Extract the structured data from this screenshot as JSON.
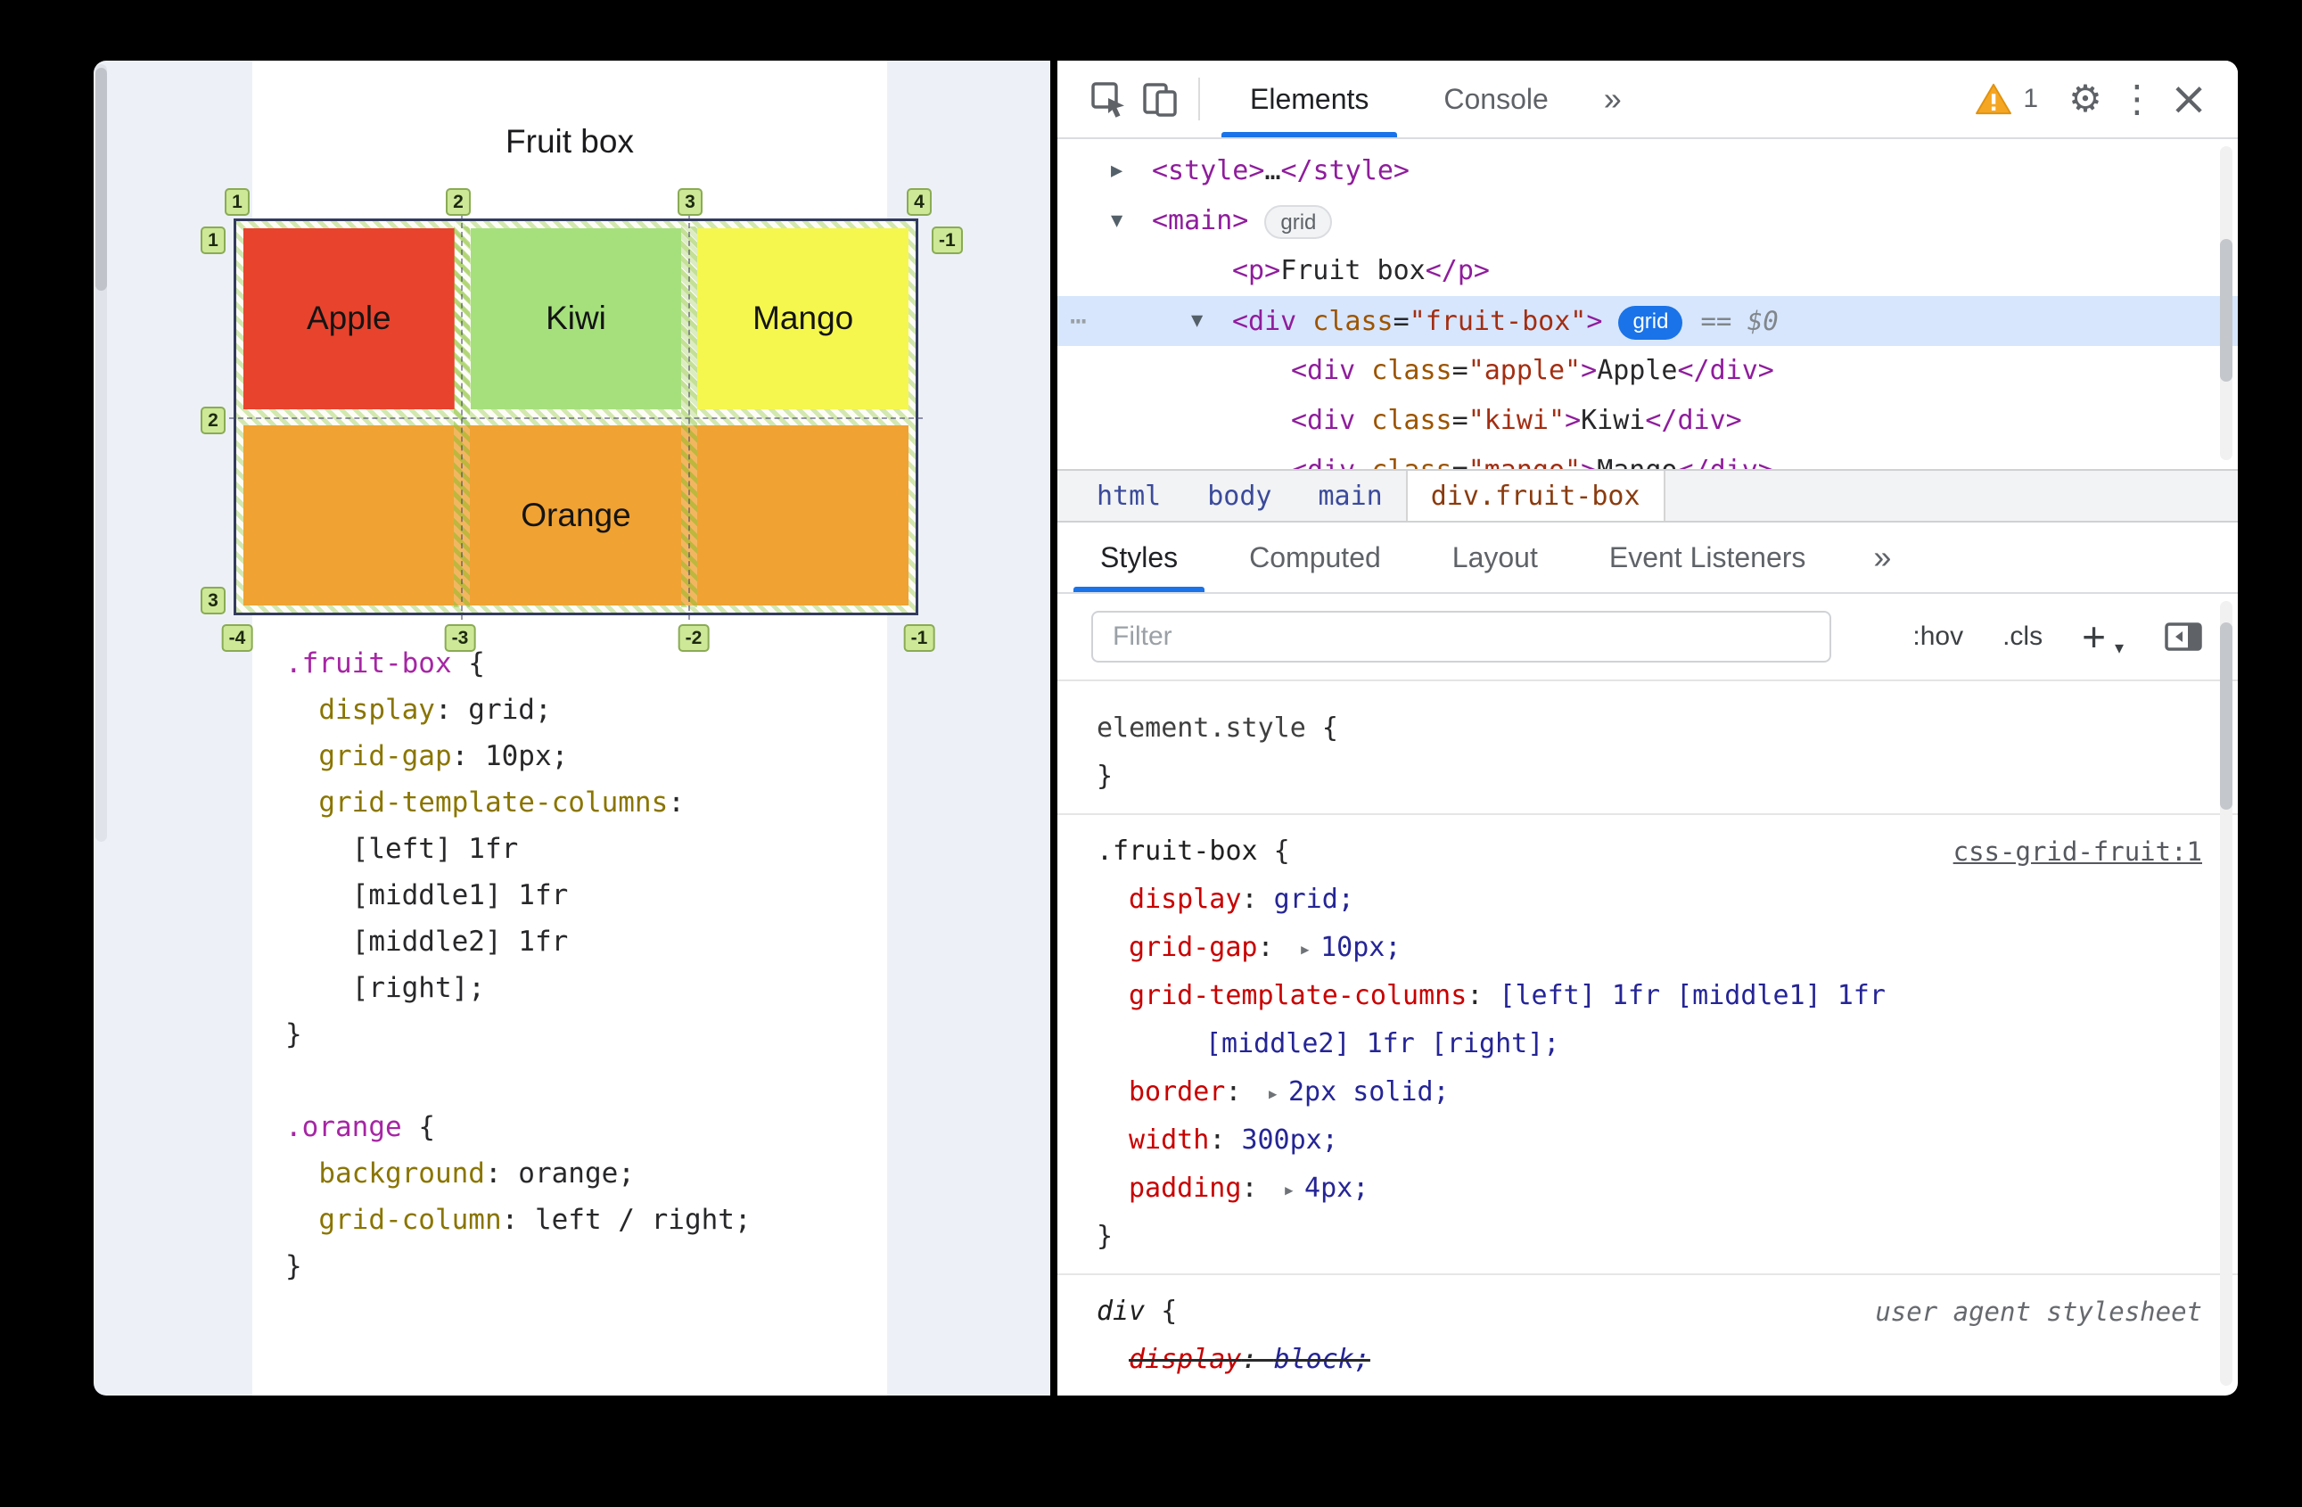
{
  "page": {
    "title": "Fruit box",
    "grid": {
      "cells": [
        {
          "label": "Apple",
          "color": "#e8432d"
        },
        {
          "label": "Kiwi",
          "color": "#a6e07d"
        },
        {
          "label": "Mango",
          "color": "#f5f74e"
        },
        {
          "label": "Orange",
          "color": "#f0a233",
          "span": 3
        }
      ],
      "line_numbers": {
        "top": [
          "1",
          "2",
          "3",
          "4"
        ],
        "right": [
          "-1"
        ],
        "left": [
          "1",
          "2",
          "3"
        ],
        "bottom": [
          "-4",
          "-3",
          "-2",
          "-1"
        ]
      }
    },
    "code_lines": [
      [
        [
          "sel",
          ".fruit-box"
        ],
        [
          "pln",
          " {"
        ]
      ],
      [
        [
          "pln",
          "  "
        ],
        [
          "prop",
          "display"
        ],
        [
          "pln",
          ": grid;"
        ]
      ],
      [
        [
          "pln",
          "  "
        ],
        [
          "prop",
          "grid-gap"
        ],
        [
          "pln",
          ": 10px;"
        ]
      ],
      [
        [
          "pln",
          "  "
        ],
        [
          "prop",
          "grid-template-columns"
        ],
        [
          "pln",
          ":"
        ]
      ],
      [
        [
          "pln",
          "    [left] 1fr"
        ]
      ],
      [
        [
          "pln",
          "    [middle1] 1fr"
        ]
      ],
      [
        [
          "pln",
          "    [middle2] 1fr"
        ]
      ],
      [
        [
          "pln",
          "    [right];"
        ]
      ],
      [
        [
          "pln",
          "}"
        ]
      ],
      [],
      [
        [
          "sel",
          ".orange"
        ],
        [
          "pln",
          " {"
        ]
      ],
      [
        [
          "pln",
          "  "
        ],
        [
          "prop",
          "background"
        ],
        [
          "pln",
          ": orange;"
        ]
      ],
      [
        [
          "pln",
          "  "
        ],
        [
          "prop",
          "grid-column"
        ],
        [
          "pln",
          ": left / right;"
        ]
      ],
      [
        [
          "pln",
          "}"
        ]
      ]
    ]
  },
  "devtools": {
    "toolbar": {
      "tabs": [
        {
          "label": "Elements",
          "active": true
        },
        {
          "label": "Console",
          "active": false
        }
      ],
      "more": "»",
      "warning_count": "1",
      "gear": "⚙",
      "kebab": "⋮",
      "close": "×"
    },
    "dom_tree": [
      {
        "indent": 0,
        "arrow": "▶",
        "tokens": [
          [
            "tag",
            "<style>"
          ],
          [
            "pln",
            "…"
          ],
          [
            "tag",
            "</style>"
          ]
        ]
      },
      {
        "indent": 0,
        "arrow": "▼",
        "tokens": [
          [
            "tag",
            "<main>"
          ]
        ],
        "badge": {
          "label": "grid",
          "style": "gray"
        }
      },
      {
        "indent": 1,
        "tokens": [
          [
            "tag",
            "<p>"
          ],
          [
            "pln",
            "Fruit box"
          ],
          [
            "tag",
            "</p>"
          ]
        ]
      },
      {
        "indent": 1,
        "arrow": "▼",
        "selected": true,
        "dots": "⋯",
        "tokens": [
          [
            "tag",
            "<div"
          ],
          [
            "attr",
            " class"
          ],
          [
            "pln",
            "="
          ],
          [
            "val",
            "\"fruit-box\""
          ],
          [
            "tag",
            ">"
          ]
        ],
        "badge": {
          "label": "grid",
          "style": "blue"
        },
        "suffix": "== $0"
      },
      {
        "indent": 2,
        "tokens": [
          [
            "tag",
            "<div"
          ],
          [
            "attr",
            " class"
          ],
          [
            "pln",
            "="
          ],
          [
            "val",
            "\"apple\""
          ],
          [
            "tag",
            ">"
          ],
          [
            "pln",
            "Apple"
          ],
          [
            "tag",
            "</div>"
          ]
        ]
      },
      {
        "indent": 2,
        "tokens": [
          [
            "tag",
            "<div"
          ],
          [
            "attr",
            " class"
          ],
          [
            "pln",
            "="
          ],
          [
            "val",
            "\"kiwi\""
          ],
          [
            "tag",
            ">"
          ],
          [
            "pln",
            "Kiwi"
          ],
          [
            "tag",
            "</div>"
          ]
        ]
      },
      {
        "indent": 2,
        "tokens": [
          [
            "tag",
            "<div"
          ],
          [
            "attr",
            " class"
          ],
          [
            "pln",
            "="
          ],
          [
            "val",
            "\"mango\""
          ],
          [
            "tag",
            ">"
          ],
          [
            "pln",
            "Mango"
          ],
          [
            "tag",
            "</div>"
          ]
        ]
      }
    ],
    "breadcrumbs": [
      {
        "label": "html"
      },
      {
        "label": "body"
      },
      {
        "label": "main"
      },
      {
        "label": "div.fruit-box",
        "active": true
      }
    ],
    "styles_tabs": [
      {
        "label": "Styles",
        "active": true
      },
      {
        "label": "Computed"
      },
      {
        "label": "Layout"
      },
      {
        "label": "Event Listeners"
      }
    ],
    "styles_more": "»",
    "filter": {
      "placeholder": "Filter",
      "hov": ":hov",
      "cls": ".cls",
      "add": "+",
      "caret": "▾"
    },
    "expand_icon": "▸",
    "style_rules": [
      {
        "selector": "element.style",
        "kind": "elstyle",
        "open": " {",
        "close": "}",
        "properties": []
      },
      {
        "selector": ".fruit-box",
        "open": " {",
        "close": "}",
        "source": "css-grid-fruit:1",
        "source_link": true,
        "properties": [
          {
            "name": "display",
            "value": "grid;"
          },
          {
            "name": "grid-gap",
            "expand": true,
            "value": "10px;"
          },
          {
            "name": "grid-template-columns",
            "value": "[left] 1fr [middle1] 1fr",
            "value_wrap": "[middle2] 1fr [right];"
          },
          {
            "name": "border",
            "expand": true,
            "value": "2px solid;"
          },
          {
            "name": "width",
            "value": "300px;"
          },
          {
            "name": "padding",
            "expand": true,
            "value": "4px;"
          }
        ]
      },
      {
        "selector": "div",
        "italic": true,
        "open": " {",
        "close": "}",
        "source": "user agent stylesheet",
        "source_link": false,
        "properties": [
          {
            "name": "display",
            "value": "block;",
            "struck": true
          }
        ]
      }
    ]
  }
}
